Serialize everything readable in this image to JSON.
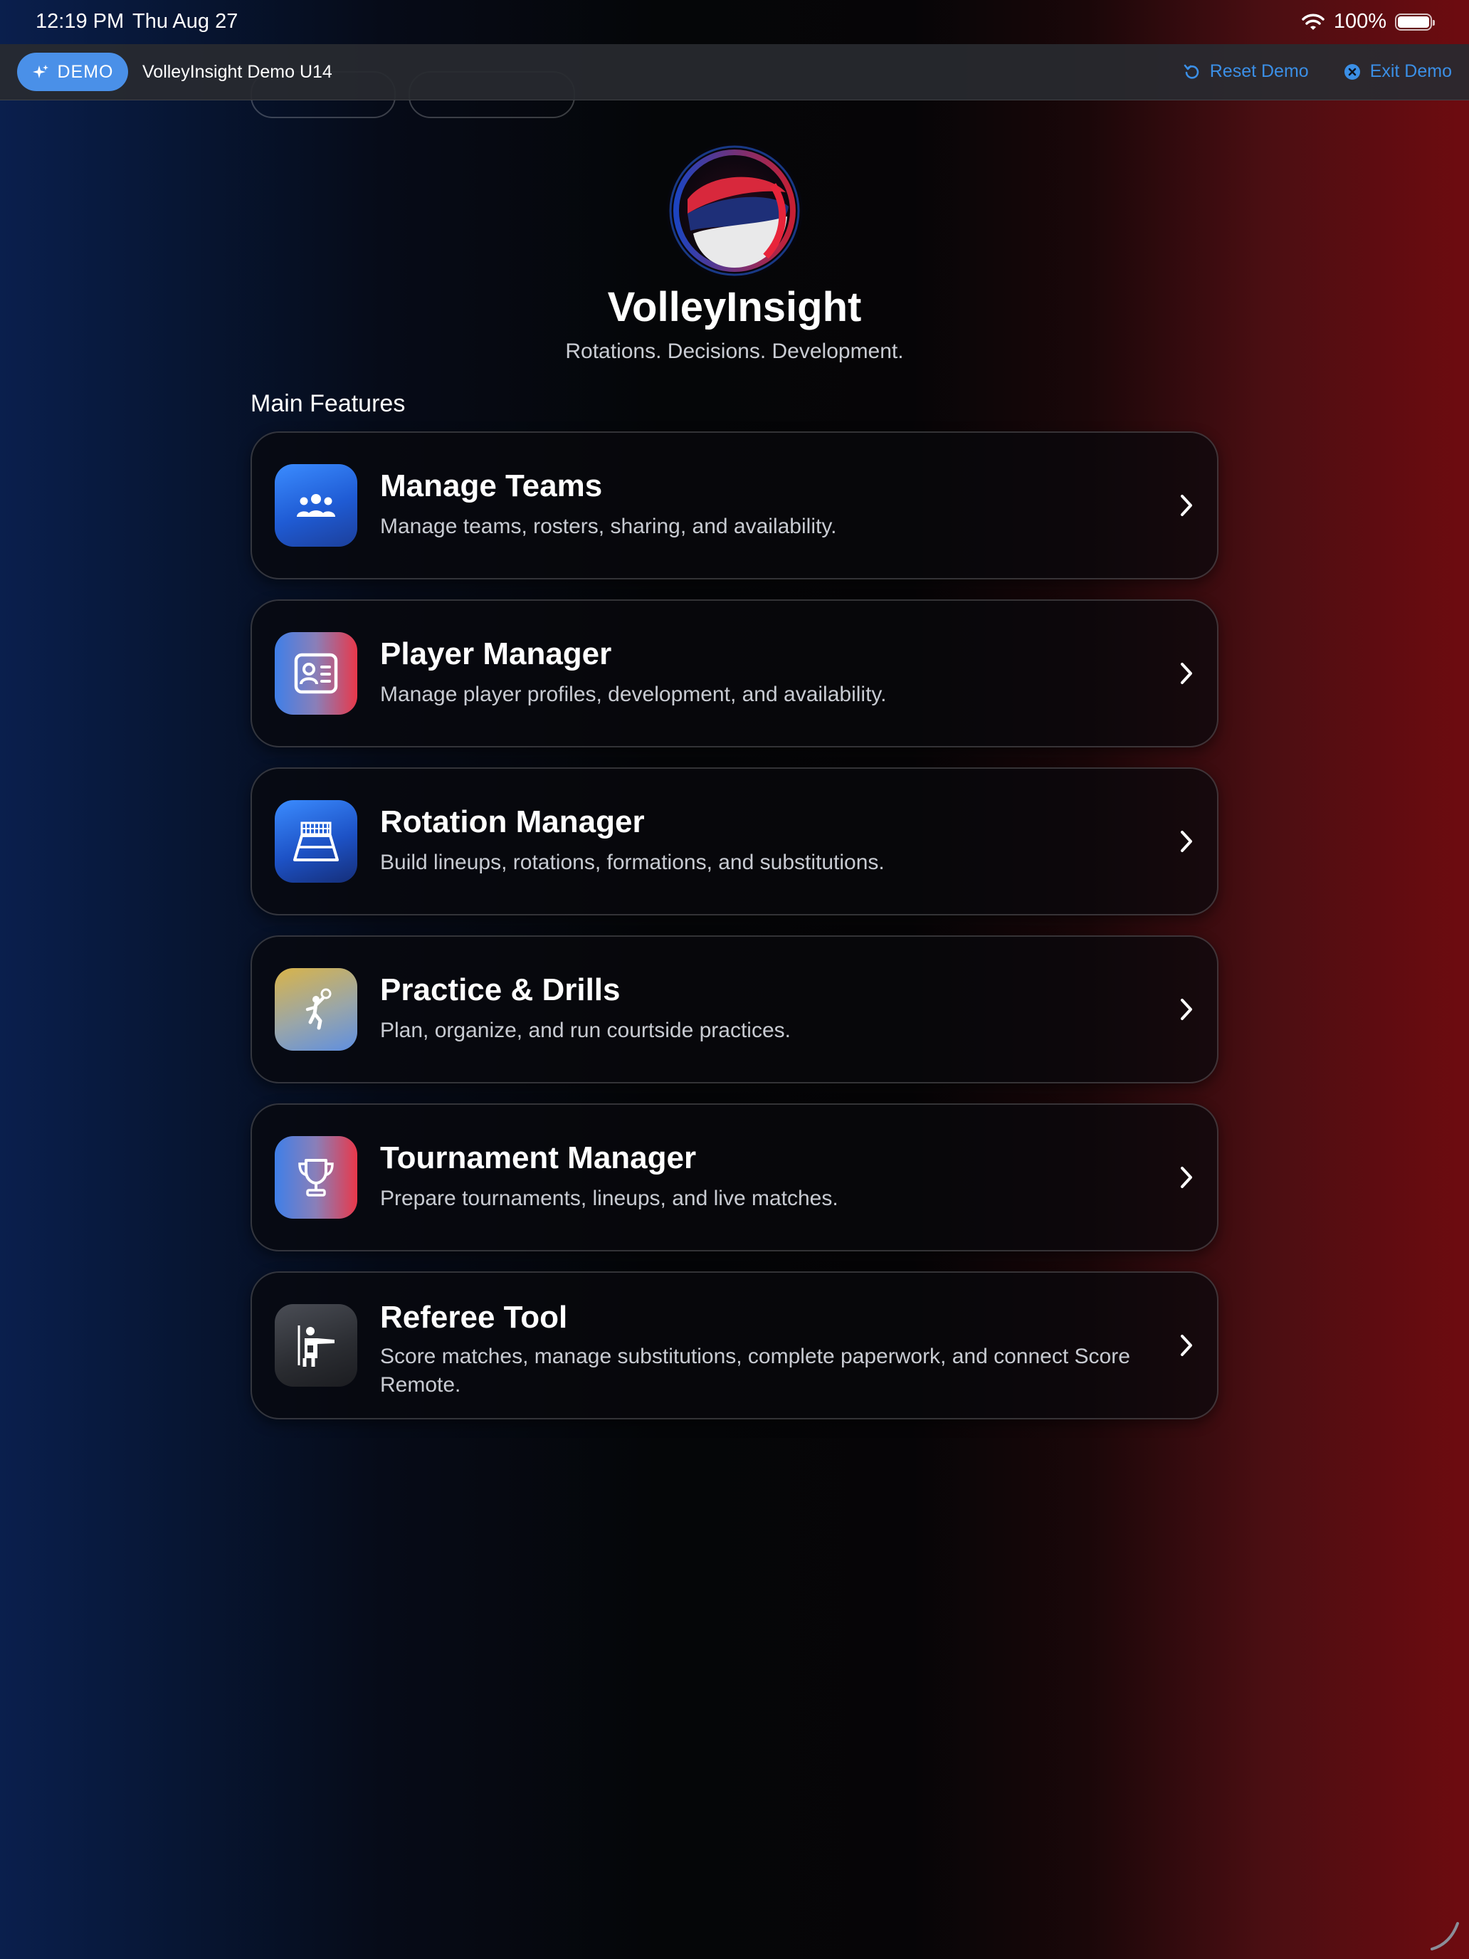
{
  "status_bar": {
    "time": "12:19 PM",
    "date": "Thu Aug 27",
    "battery": "100%"
  },
  "demo_bar": {
    "badge": "DEMO",
    "team_name": "VolleyInsight Demo U14",
    "reset_label": "Reset Demo",
    "exit_label": "Exit Demo",
    "accent": "#3b8fe6"
  },
  "hero": {
    "title": "VolleyInsight",
    "tagline": "Rotations. Decisions. Development."
  },
  "section_title": "Main Features",
  "features": [
    {
      "title": "Manage Teams",
      "description": "Manage teams, rosters, sharing, and availability.",
      "icon": "people-icon"
    },
    {
      "title": "Player Manager",
      "description": "Manage player profiles, development, and availability.",
      "icon": "id-card-icon"
    },
    {
      "title": "Rotation Manager",
      "description": "Build lineups, rotations, formations, and substitutions.",
      "icon": "volleyball-court-icon"
    },
    {
      "title": "Practice & Drills",
      "description": "Plan, organize, and run courtside practices.",
      "icon": "volleyball-player-icon"
    },
    {
      "title": "Tournament Manager",
      "description": "Prepare tournaments, lineups, and live matches.",
      "icon": "trophy-icon"
    },
    {
      "title": "Referee Tool",
      "description": "Score matches, manage substitutions, complete paperwork, and connect Score Remote.",
      "icon": "referee-icon"
    }
  ]
}
